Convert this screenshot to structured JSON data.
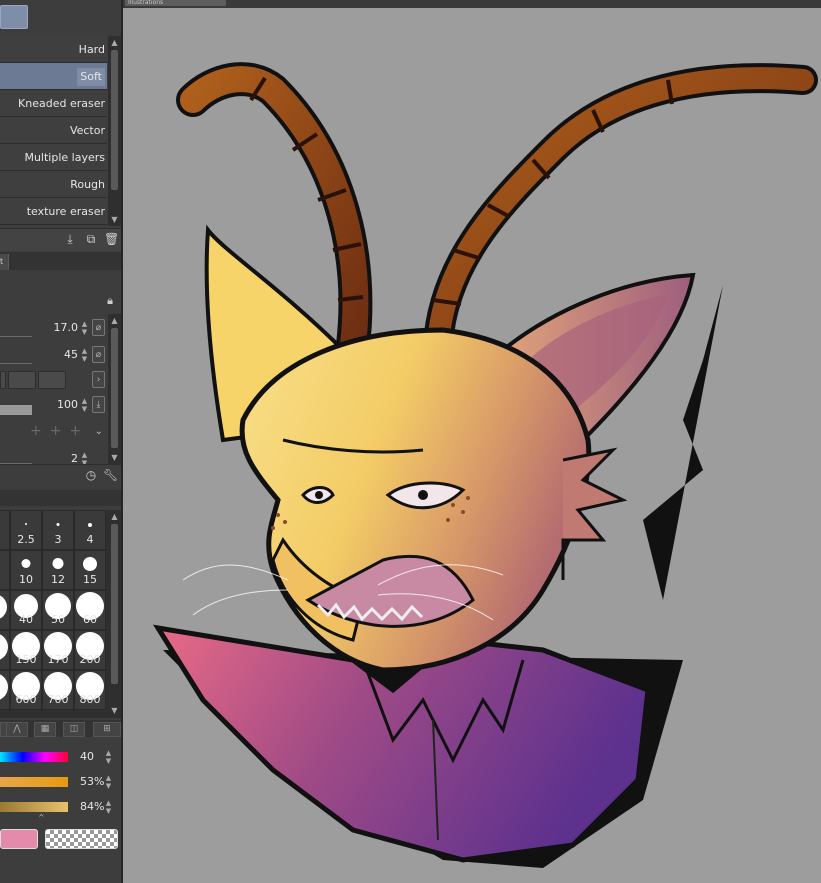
{
  "eraser_subtools": [
    {
      "label": "Hard",
      "selected": false
    },
    {
      "label": "Soft",
      "selected": true
    },
    {
      "label": "Kneaded eraser",
      "selected": false
    },
    {
      "label": "Vector",
      "selected": false
    },
    {
      "label": "Multiple layers",
      "selected": false
    },
    {
      "label": "Rough",
      "selected": false
    },
    {
      "label": "texture eraser",
      "selected": false
    }
  ],
  "subtool_toolbar": {
    "icons": [
      "import-icon",
      "duplicate-icon",
      "trash-icon"
    ]
  },
  "tool_properties": {
    "tab_label": "t",
    "lock_icon": "lock-icon",
    "brush_size": "17.0",
    "hardness": "45",
    "opacity": "100",
    "density": "2"
  },
  "brush_sizes": {
    "row1": [
      "2.5",
      "3",
      "4"
    ],
    "row2": [
      "10",
      "12",
      "15"
    ],
    "row3": [
      "40",
      "50",
      "60"
    ],
    "row4": [
      "150",
      "170",
      "200"
    ],
    "row5": [
      "600",
      "700",
      "800"
    ]
  },
  "color_panel": {
    "hue": "40",
    "saturation": "53%",
    "brightness": "84%",
    "main_color": "#e48aaa",
    "bar_colors": {
      "sat": "#e59a12",
      "bri": "#d4a44a"
    }
  },
  "canvas": {
    "doc_tab_title": "Illustrations",
    "background": "#9d9d9d"
  },
  "artwork": {
    "subject": "antelope-character",
    "colors": {
      "fur_light": "#f6d46a",
      "fur_dark": "#c9826c",
      "horn": "#8a4418",
      "shirt_pink": "#e06c8c",
      "shirt_purple": "#6b3590",
      "outline": "#111111"
    }
  }
}
